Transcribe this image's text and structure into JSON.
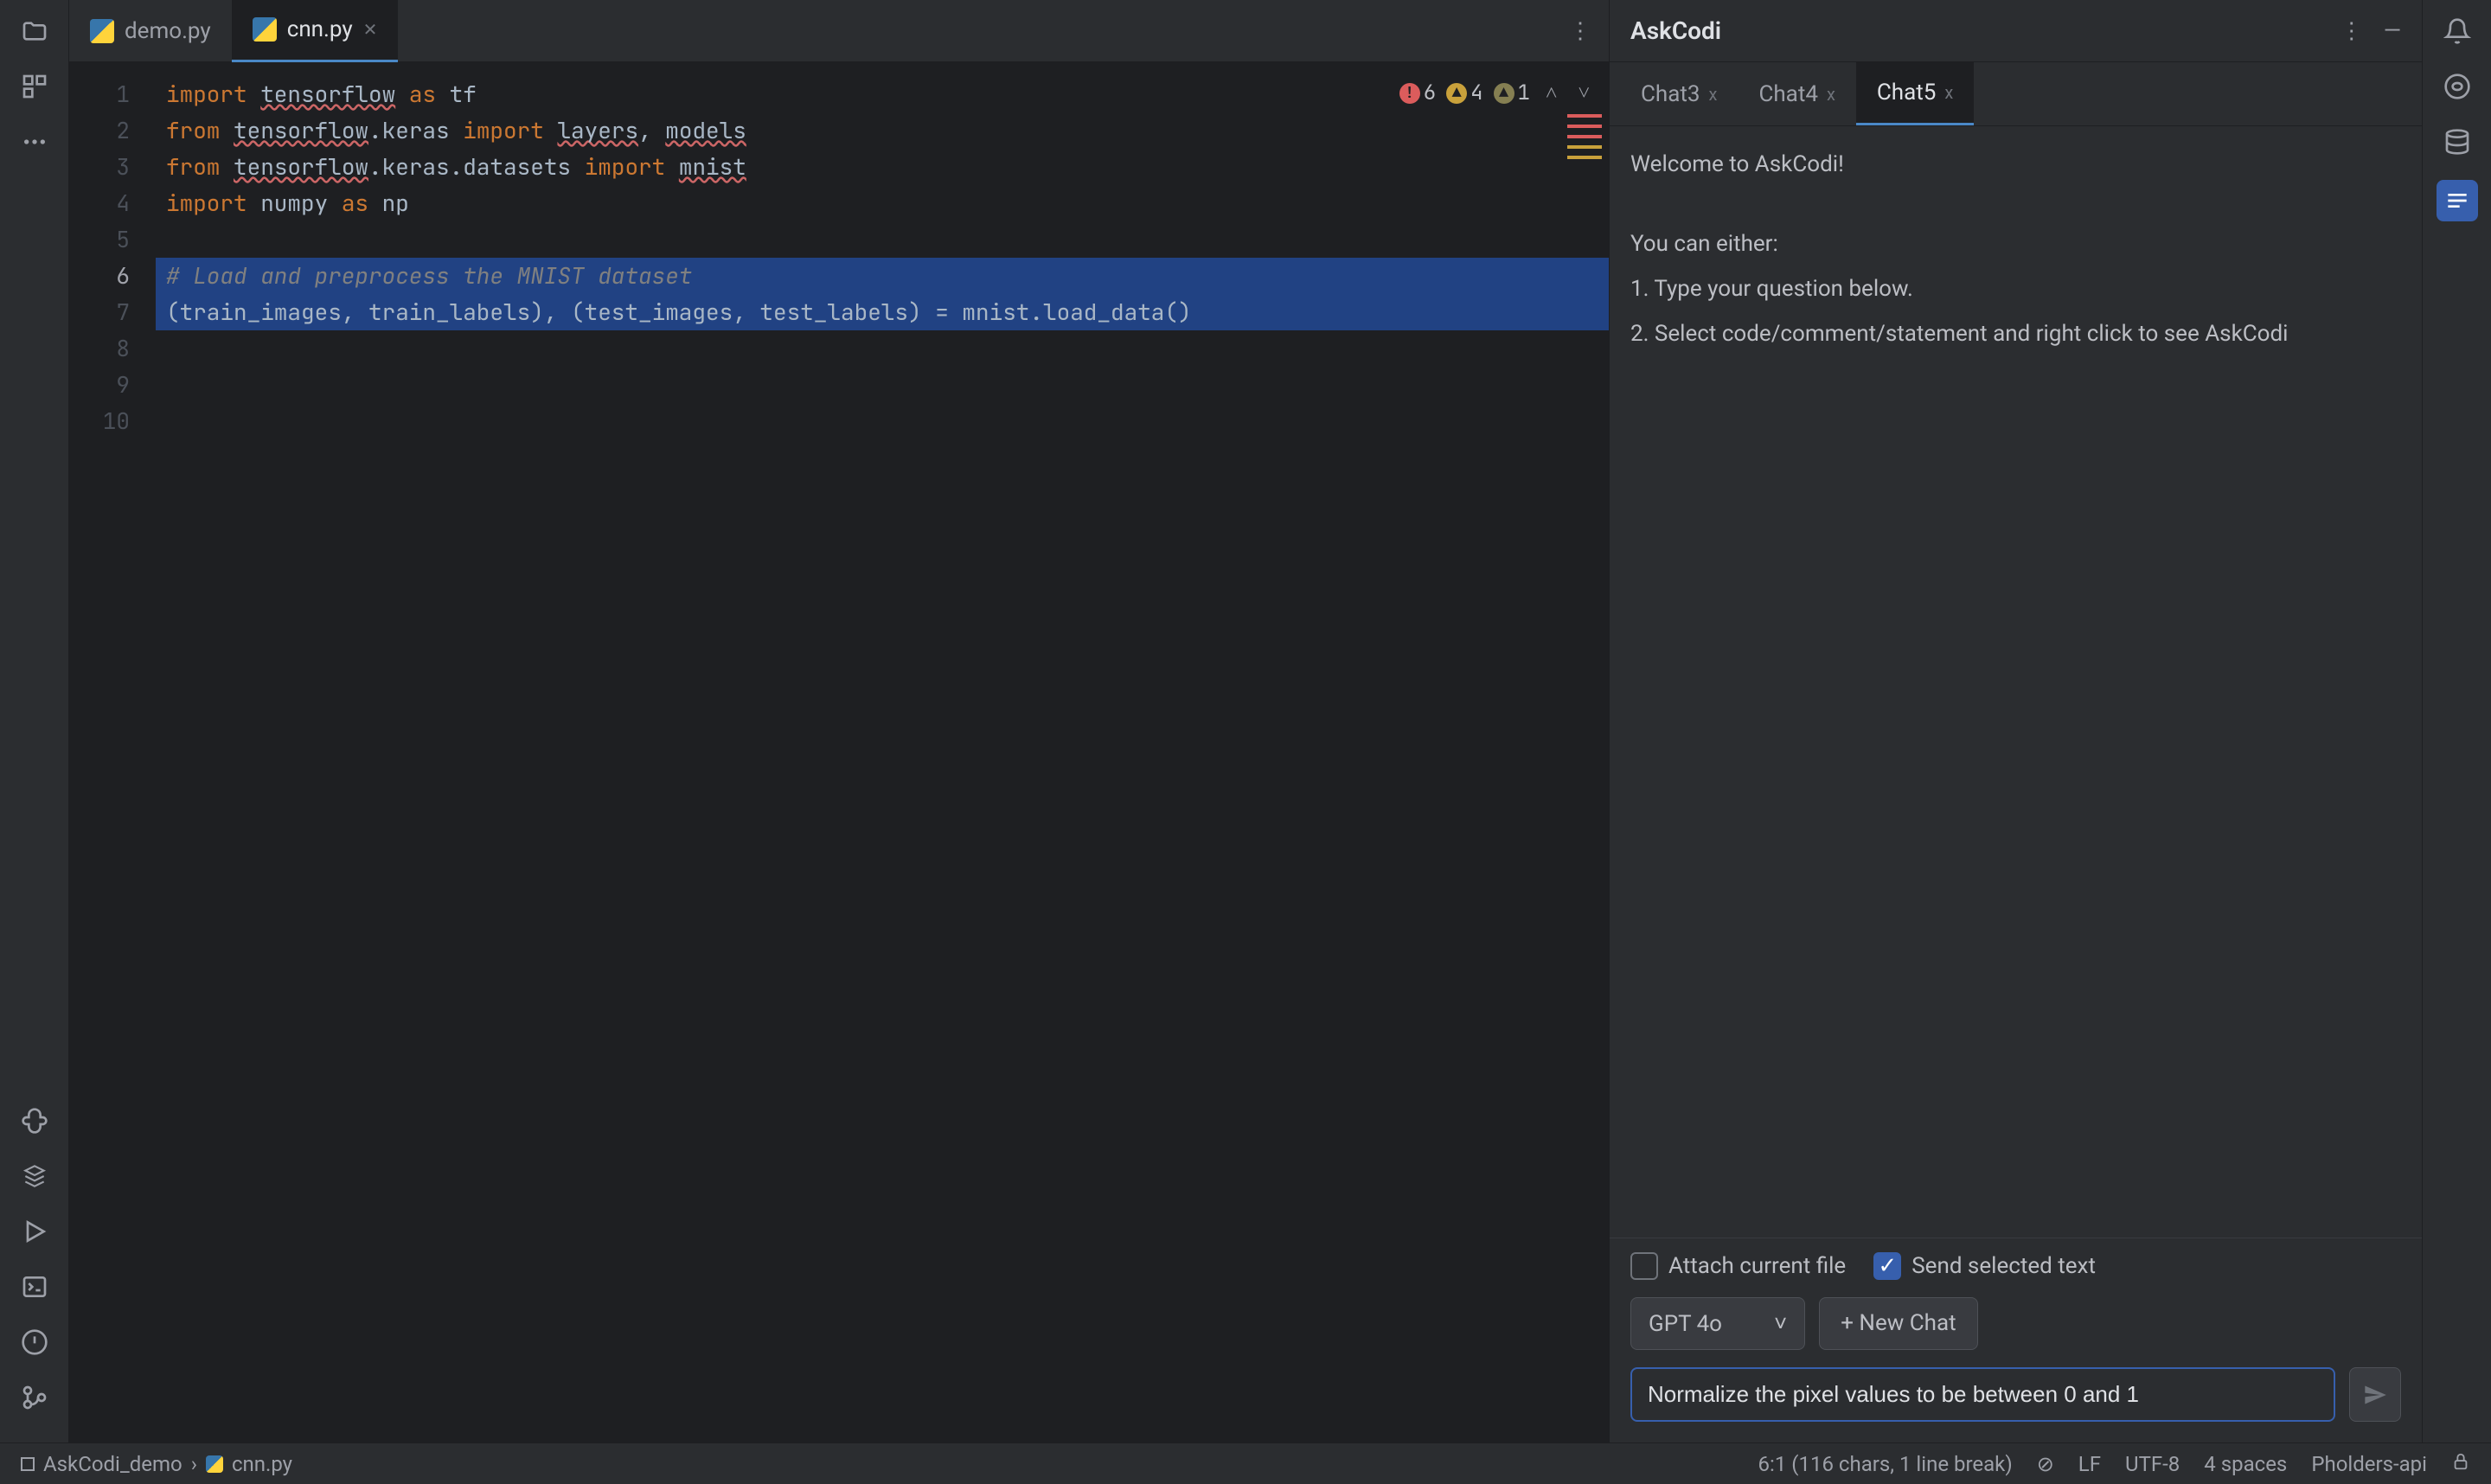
{
  "tabs": {
    "files": [
      {
        "name": "demo.py",
        "active": false
      },
      {
        "name": "cnn.py",
        "active": true
      }
    ]
  },
  "diagnostics": {
    "errors": "6",
    "warnings": "4",
    "info": "1"
  },
  "code": {
    "lines": [
      {
        "n": "1",
        "html": "<span class='kw'>import </span><span class='id err'>tensorflow</span><span class='id'> </span><span class='kw'>as</span><span class='id'> tf</span>"
      },
      {
        "n": "2",
        "html": "<span class='kw'>from </span><span class='id err'>tensorflow</span><span class='id'>.keras </span><span class='kw'>import </span><span class='id err'>layers</span><span class='id'>, </span><span class='id err'>models</span>"
      },
      {
        "n": "3",
        "html": "<span class='kw'>from </span><span class='id err'>tensorflow</span><span class='id'>.keras.datasets </span><span class='kw'>import </span><span class='id err'>mnist</span>"
      },
      {
        "n": "4",
        "html": "<span class='kw'>import </span><span class='id'>numpy </span><span class='kw'>as</span><span class='id'> np</span>"
      },
      {
        "n": "5",
        "html": ""
      },
      {
        "n": "6",
        "sel": true,
        "html": "<span class='cm'># Load and preprocess the MNIST dataset</span>"
      },
      {
        "n": "7",
        "sel": true,
        "html": "<span class='id'>(train_images, train_labels), (test_images, test_labels) = mnist.load_data()</span>"
      },
      {
        "n": "8",
        "html": ""
      },
      {
        "n": "9",
        "html": ""
      },
      {
        "n": "10",
        "html": ""
      }
    ]
  },
  "askcodi": {
    "title": "AskCodi",
    "tabs": [
      {
        "label": "Chat3",
        "active": false
      },
      {
        "label": "Chat4",
        "active": false
      },
      {
        "label": "Chat5",
        "active": true
      }
    ],
    "welcome": "Welcome to AskCodi!",
    "either": "You can either:",
    "opt1": "1. Type your question below.",
    "opt2": "2. Select code/comment/statement and right click to see AskCodi",
    "attach_label": "Attach current file",
    "send_sel_label": "Send selected text",
    "model": "GPT 4o",
    "new_chat": "+ New Chat",
    "input_value": "Normalize the pixel values to be between 0 and 1"
  },
  "status": {
    "project": "AskCodi_demo",
    "file": "cnn.py",
    "pos": "6:1 (116 chars, 1 line break)",
    "le": "LF",
    "enc": "UTF-8",
    "indent": "4 spaces",
    "extra": "Pholders-api"
  }
}
